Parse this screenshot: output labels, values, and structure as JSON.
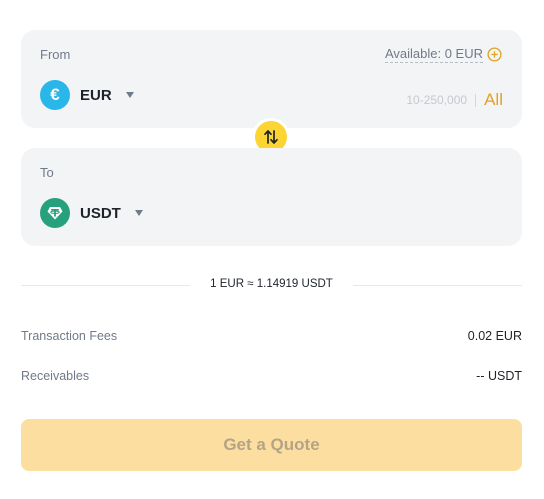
{
  "from": {
    "label": "From",
    "available": "Available: 0 EUR",
    "asset": "EUR",
    "amount_placeholder": "10-250,000",
    "all_label": "All"
  },
  "to": {
    "label": "To",
    "asset": "USDT"
  },
  "rate": "1 EUR ≈ 1.14919 USDT",
  "fees": {
    "label": "Transaction Fees",
    "value": "0.02 EUR"
  },
  "receivables": {
    "label": "Receivables",
    "value": "-- USDT"
  },
  "submit_label": "Get a Quote",
  "colors": {
    "accent": "#fcd535",
    "link": "#e0a322",
    "eur": "#29b6e8",
    "usdt": "#26a17b"
  },
  "icons": [
    "plus-circle-icon",
    "eur-coin-icon",
    "usdt-coin-icon",
    "caret-down-icon",
    "swap-icon"
  ]
}
